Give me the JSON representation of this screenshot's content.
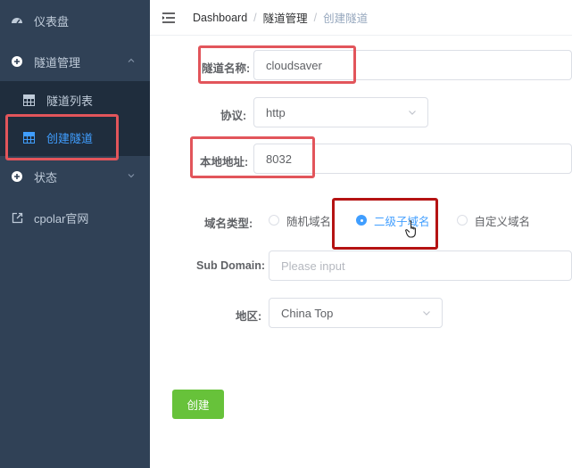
{
  "sidebar": {
    "items": [
      {
        "label": "仪表盘",
        "icon": "dashboard-icon"
      },
      {
        "label": "隧道管理",
        "icon": "plus-circle-icon"
      },
      {
        "label": "状态",
        "icon": "plus-circle-icon"
      },
      {
        "label": "cpolar官网",
        "icon": "external-link-icon"
      }
    ],
    "submenu": [
      {
        "label": "隧道列表",
        "icon": "grid-icon"
      },
      {
        "label": "创建隧道",
        "icon": "grid-icon",
        "active": true
      }
    ]
  },
  "header": {
    "breadcrumb": [
      "Dashboard",
      "隧道管理",
      "创建隧道"
    ]
  },
  "form": {
    "tunnel_name_label": "隧道名称:",
    "tunnel_name_value": "cloudsaver",
    "protocol_label": "协议:",
    "protocol_value": "http",
    "local_address_label": "本地地址:",
    "local_address_value": "8032",
    "domain_type_label": "域名类型:",
    "domain_type_options": [
      "随机域名",
      "二级子域名",
      "自定义域名"
    ],
    "domain_type_selected": "二级子域名",
    "subdomain_label": "Sub Domain:",
    "subdomain_placeholder": "Please input",
    "region_label": "地区:",
    "region_value": "China Top",
    "create_button": "创建"
  },
  "colors": {
    "sidebar_bg": "#304156",
    "submenu_bg": "#1f2d3d",
    "active": "#409eff",
    "create_button": "#67c23a",
    "highlight": "#e2555b"
  }
}
